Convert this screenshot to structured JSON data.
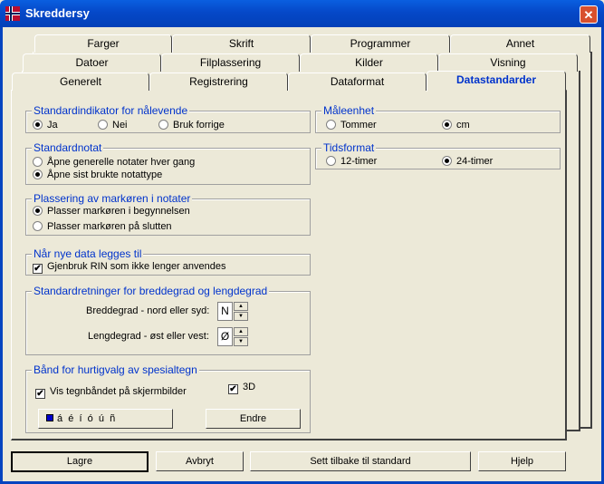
{
  "window": {
    "title": "Skreddersy",
    "close_glyph": "✕",
    "icon": "norwegian-flag-icon"
  },
  "tabs": {
    "row_back": [
      "Farger",
      "Skrift",
      "Programmer",
      "Annet"
    ],
    "row_middle": [
      "Datoer",
      "Filplassering",
      "Kilder",
      "Visning"
    ],
    "row_front": [
      "Generelt",
      "Registrering",
      "Dataformat",
      "Datastandarder"
    ],
    "active": "Datastandarder"
  },
  "groups": {
    "standardindikator": {
      "title": "Standardindikator for nålevende",
      "options": [
        {
          "label": "Ja",
          "selected": true
        },
        {
          "label": "Nei",
          "selected": false
        },
        {
          "label": "Bruk forrige",
          "selected": false
        }
      ]
    },
    "standardnotat": {
      "title": "Standardnotat",
      "options": [
        {
          "label": "Åpne generelle notater hver gang",
          "selected": false
        },
        {
          "label": "Åpne sist brukte notattype",
          "selected": true
        }
      ]
    },
    "plassering": {
      "title": "Plassering av markøren i notater",
      "options": [
        {
          "label": "Plasser markøren i begynnelsen",
          "selected": true
        },
        {
          "label": "Plasser markøren på slutten",
          "selected": false
        }
      ]
    },
    "nye_data": {
      "title": "Når nye data legges til",
      "checkbox": {
        "label": "Gjenbruk RIN som ikke lenger anvendes",
        "checked": true
      }
    },
    "retninger": {
      "title": "Standardretninger for breddegrad og lengdegrad",
      "breddegrad_label": "Breddegrad - nord eller syd:",
      "breddegrad_value": "N",
      "lengdegrad_label": "Lengdegrad - øst eller vest:",
      "lengdegrad_value": "Ø",
      "spin_up": "▲",
      "spin_down": "▼"
    },
    "spesialtegn": {
      "title": "Bånd for hurtigvalg av spesialtegn",
      "vis_label": "Vis tegnbåndet på skjermbilder",
      "vis_checked": true,
      "threed_label": "3D",
      "threed_checked": true,
      "chars": "á  é  í  ó  ú  ñ",
      "endre": "Endre"
    },
    "maleenhet": {
      "title": "Måleenhet",
      "options": [
        {
          "label": "Tommer",
          "selected": false
        },
        {
          "label": "cm",
          "selected": true
        }
      ]
    },
    "tidsformat": {
      "title": "Tidsformat",
      "options": [
        {
          "label": "12-timer",
          "selected": false
        },
        {
          "label": "24-timer",
          "selected": true
        }
      ]
    }
  },
  "buttons": {
    "lagre": "Lagre",
    "avbryt": "Avbryt",
    "standard": "Sett tilbake til standard",
    "hjelp": "Hjelp"
  },
  "check_glyph": "✔"
}
